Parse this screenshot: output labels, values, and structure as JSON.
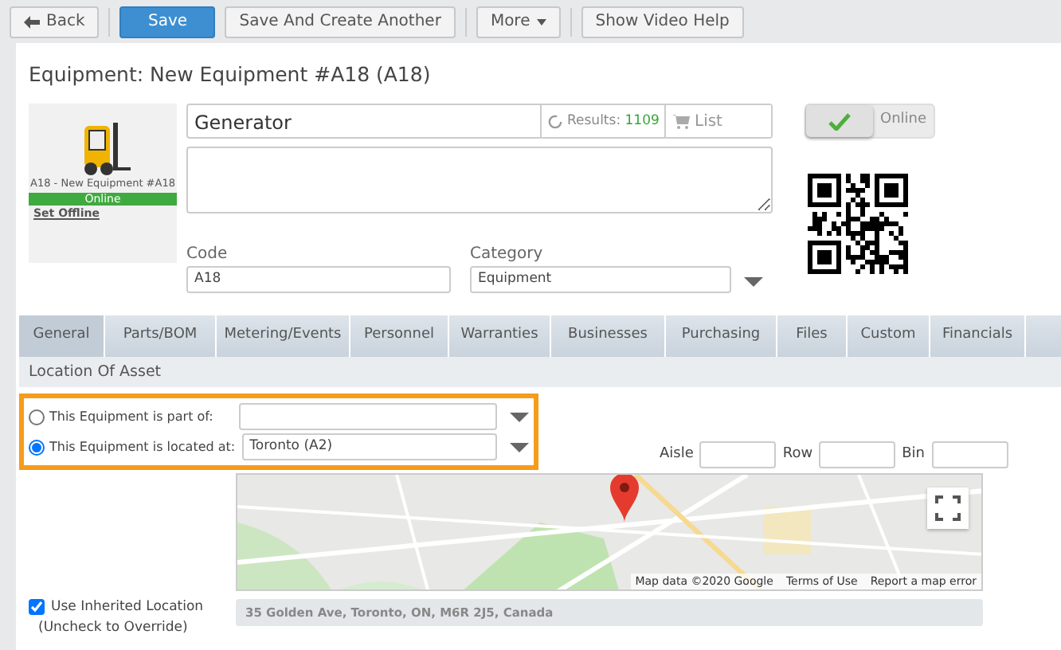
{
  "toolbar": [
    {
      "label": "Back",
      "kind": "back"
    },
    {
      "label": "Save",
      "kind": "primary"
    },
    {
      "label": "Save And Create Another",
      "kind": "default"
    },
    {
      "label": "More",
      "kind": "dropdown"
    },
    {
      "label": "Show Video Help",
      "kind": "default"
    }
  ],
  "title": "Equipment: New Equipment #A18 (A18)",
  "asset": {
    "caption": "A18 - New Equipment #A18",
    "status": "Online",
    "action": "Set Offline"
  },
  "name_field": {
    "value": "Generator",
    "results_label": "Results:",
    "results_count": "1109",
    "list_label": "List"
  },
  "online_toggle": {
    "on": true,
    "label": "Online"
  },
  "code": {
    "label": "Code",
    "value": "A18"
  },
  "category": {
    "label": "Category",
    "value": "Equipment"
  },
  "tabs": [
    {
      "label": "General",
      "selected": true
    },
    {
      "label": "Parts/BOM",
      "selected": false
    },
    {
      "label": "Metering/Events",
      "selected": false
    },
    {
      "label": "Personnel",
      "selected": false
    },
    {
      "label": "Warranties",
      "selected": false
    },
    {
      "label": "Businesses",
      "selected": false
    },
    {
      "label": "Purchasing",
      "selected": false
    },
    {
      "label": "Files",
      "selected": false
    },
    {
      "label": "Custom",
      "selected": false
    },
    {
      "label": "Financials",
      "selected": false
    }
  ],
  "section_title": "Location Of Asset",
  "location_options": [
    {
      "label": "This Equipment is part of:",
      "selected": false
    },
    {
      "label": "This Equipment is located at:",
      "value": "Toronto (A2)",
      "selected": true
    }
  ],
  "storage_fields": [
    {
      "label": "Aisle"
    },
    {
      "label": "Row"
    },
    {
      "label": "Bin"
    }
  ],
  "map": {
    "attribution": [
      "Map data ©2020 Google",
      "Terms of Use",
      "Report a map error"
    ]
  },
  "inherited": {
    "checked": true,
    "label": "Use Inherited Location",
    "hint": "(Uncheck to Override)",
    "address": "35 Golden Ave, Toronto, ON, M6R 2J5, Canada"
  }
}
